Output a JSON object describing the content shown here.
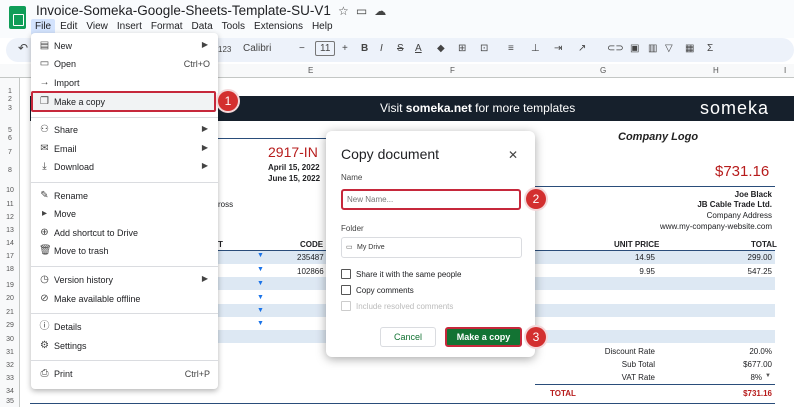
{
  "doc": {
    "title": "Invoice-Someka-Google-Sheets-Template-SU-V1"
  },
  "menubar": [
    "File",
    "Edit",
    "View",
    "Insert",
    "Format",
    "Data",
    "Tools",
    "Extensions",
    "Help"
  ],
  "toolbar": {
    "font": "Calibri",
    "font_size": "11",
    "num_fmt": "123"
  },
  "columns": [
    "E",
    "F",
    "G",
    "H",
    "I"
  ],
  "rows": [
    "1",
    "2",
    "3",
    "5",
    "6",
    "7",
    "8",
    "10",
    "11",
    "12",
    "13",
    "14",
    "17",
    "18",
    "19",
    "20",
    "21",
    "29",
    "30",
    "31",
    "32",
    "33",
    "34",
    "35",
    "36"
  ],
  "banner": {
    "prefix": "Visit ",
    "site": "someka.net",
    "suffix": " for more templates",
    "logo": "someka"
  },
  "invoice": {
    "number": "2917-IN",
    "date1": "April 15, 2022",
    "date2": "June 15, 2022",
    "partial": "ross",
    "col_t": "T",
    "col_code": "CODE",
    "code1": "235487",
    "code2": "102866",
    "company_logo": "Company Logo",
    "amount": "$731.16",
    "client_name": "Joe Black",
    "client_company": "JB Cable Trade Ltd.",
    "client_address": "Company Address",
    "client_web": "www.my-company-website.com",
    "unit_price_header": "UNIT PRICE",
    "total_header": "TOTAL",
    "up1": "14.95",
    "t1": "299.00",
    "up2": "9.95",
    "t2": "547.25",
    "discount_label": "Discount Rate",
    "discount_value": "20.0%",
    "subtotal_label": "Sub Total",
    "subtotal_value": "$677.00",
    "vat_label": "VAT Rate",
    "vat_value": "8%",
    "total_label": "TOTAL",
    "total_value": "$731.16"
  },
  "file_menu": {
    "new": "New",
    "open": "Open",
    "open_shortcut": "Ctrl+O",
    "import": "Import",
    "make_copy": "Make a copy",
    "share": "Share",
    "email": "Email",
    "download": "Download",
    "rename": "Rename",
    "move": "Move",
    "add_shortcut": "Add shortcut to Drive",
    "move_trash": "Move to trash",
    "version_history": "Version history",
    "offline": "Make available offline",
    "details": "Details",
    "settings": "Settings",
    "print": "Print",
    "print_shortcut": "Ctrl+P"
  },
  "dialog": {
    "title": "Copy document",
    "name_label": "Name",
    "name_placeholder": "New Name...",
    "folder_label": "Folder",
    "folder_value": "My Drive",
    "share_label": "Share it with the same people",
    "copy_comments_label": "Copy comments",
    "resolved_label": "Include resolved comments",
    "cancel": "Cancel",
    "make_copy": "Make a copy"
  },
  "badges": [
    "1",
    "2",
    "3"
  ],
  "colors": {
    "accent_red": "#c6283b",
    "button_green": "#137333",
    "banner": "#16202c",
    "invoice_red": "#b71c1c"
  }
}
